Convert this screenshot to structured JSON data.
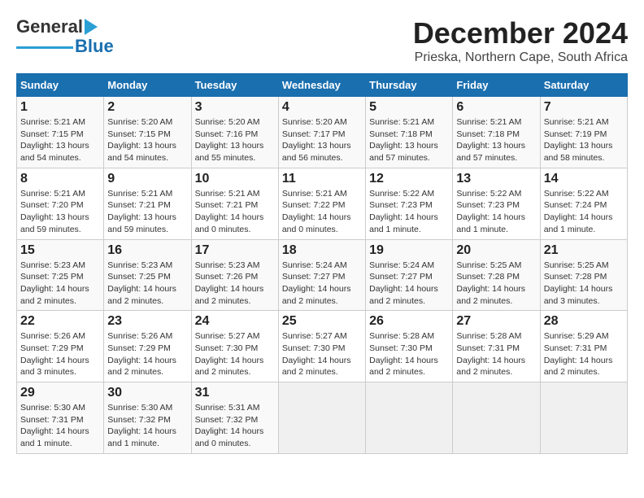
{
  "logo": {
    "line1": "General",
    "line2": "Blue"
  },
  "title": "December 2024",
  "subtitle": "Prieska, Northern Cape, South Africa",
  "days_of_week": [
    "Sunday",
    "Monday",
    "Tuesday",
    "Wednesday",
    "Thursday",
    "Friday",
    "Saturday"
  ],
  "weeks": [
    [
      {
        "day": "1",
        "info": "Sunrise: 5:21 AM\nSunset: 7:15 PM\nDaylight: 13 hours\nand 54 minutes."
      },
      {
        "day": "2",
        "info": "Sunrise: 5:20 AM\nSunset: 7:15 PM\nDaylight: 13 hours\nand 54 minutes."
      },
      {
        "day": "3",
        "info": "Sunrise: 5:20 AM\nSunset: 7:16 PM\nDaylight: 13 hours\nand 55 minutes."
      },
      {
        "day": "4",
        "info": "Sunrise: 5:20 AM\nSunset: 7:17 PM\nDaylight: 13 hours\nand 56 minutes."
      },
      {
        "day": "5",
        "info": "Sunrise: 5:21 AM\nSunset: 7:18 PM\nDaylight: 13 hours\nand 57 minutes."
      },
      {
        "day": "6",
        "info": "Sunrise: 5:21 AM\nSunset: 7:18 PM\nDaylight: 13 hours\nand 57 minutes."
      },
      {
        "day": "7",
        "info": "Sunrise: 5:21 AM\nSunset: 7:19 PM\nDaylight: 13 hours\nand 58 minutes."
      }
    ],
    [
      {
        "day": "8",
        "info": "Sunrise: 5:21 AM\nSunset: 7:20 PM\nDaylight: 13 hours\nand 59 minutes."
      },
      {
        "day": "9",
        "info": "Sunrise: 5:21 AM\nSunset: 7:21 PM\nDaylight: 13 hours\nand 59 minutes."
      },
      {
        "day": "10",
        "info": "Sunrise: 5:21 AM\nSunset: 7:21 PM\nDaylight: 14 hours\nand 0 minutes."
      },
      {
        "day": "11",
        "info": "Sunrise: 5:21 AM\nSunset: 7:22 PM\nDaylight: 14 hours\nand 0 minutes."
      },
      {
        "day": "12",
        "info": "Sunrise: 5:22 AM\nSunset: 7:23 PM\nDaylight: 14 hours\nand 1 minute."
      },
      {
        "day": "13",
        "info": "Sunrise: 5:22 AM\nSunset: 7:23 PM\nDaylight: 14 hours\nand 1 minute."
      },
      {
        "day": "14",
        "info": "Sunrise: 5:22 AM\nSunset: 7:24 PM\nDaylight: 14 hours\nand 1 minute."
      }
    ],
    [
      {
        "day": "15",
        "info": "Sunrise: 5:23 AM\nSunset: 7:25 PM\nDaylight: 14 hours\nand 2 minutes."
      },
      {
        "day": "16",
        "info": "Sunrise: 5:23 AM\nSunset: 7:25 PM\nDaylight: 14 hours\nand 2 minutes."
      },
      {
        "day": "17",
        "info": "Sunrise: 5:23 AM\nSunset: 7:26 PM\nDaylight: 14 hours\nand 2 minutes."
      },
      {
        "day": "18",
        "info": "Sunrise: 5:24 AM\nSunset: 7:27 PM\nDaylight: 14 hours\nand 2 minutes."
      },
      {
        "day": "19",
        "info": "Sunrise: 5:24 AM\nSunset: 7:27 PM\nDaylight: 14 hours\nand 2 minutes."
      },
      {
        "day": "20",
        "info": "Sunrise: 5:25 AM\nSunset: 7:28 PM\nDaylight: 14 hours\nand 2 minutes."
      },
      {
        "day": "21",
        "info": "Sunrise: 5:25 AM\nSunset: 7:28 PM\nDaylight: 14 hours\nand 3 minutes."
      }
    ],
    [
      {
        "day": "22",
        "info": "Sunrise: 5:26 AM\nSunset: 7:29 PM\nDaylight: 14 hours\nand 3 minutes."
      },
      {
        "day": "23",
        "info": "Sunrise: 5:26 AM\nSunset: 7:29 PM\nDaylight: 14 hours\nand 2 minutes."
      },
      {
        "day": "24",
        "info": "Sunrise: 5:27 AM\nSunset: 7:30 PM\nDaylight: 14 hours\nand 2 minutes."
      },
      {
        "day": "25",
        "info": "Sunrise: 5:27 AM\nSunset: 7:30 PM\nDaylight: 14 hours\nand 2 minutes."
      },
      {
        "day": "26",
        "info": "Sunrise: 5:28 AM\nSunset: 7:30 PM\nDaylight: 14 hours\nand 2 minutes."
      },
      {
        "day": "27",
        "info": "Sunrise: 5:28 AM\nSunset: 7:31 PM\nDaylight: 14 hours\nand 2 minutes."
      },
      {
        "day": "28",
        "info": "Sunrise: 5:29 AM\nSunset: 7:31 PM\nDaylight: 14 hours\nand 2 minutes."
      }
    ],
    [
      {
        "day": "29",
        "info": "Sunrise: 5:30 AM\nSunset: 7:31 PM\nDaylight: 14 hours\nand 1 minute."
      },
      {
        "day": "30",
        "info": "Sunrise: 5:30 AM\nSunset: 7:32 PM\nDaylight: 14 hours\nand 1 minute."
      },
      {
        "day": "31",
        "info": "Sunrise: 5:31 AM\nSunset: 7:32 PM\nDaylight: 14 hours\nand 0 minutes."
      },
      {
        "day": "",
        "info": ""
      },
      {
        "day": "",
        "info": ""
      },
      {
        "day": "",
        "info": ""
      },
      {
        "day": "",
        "info": ""
      }
    ]
  ]
}
